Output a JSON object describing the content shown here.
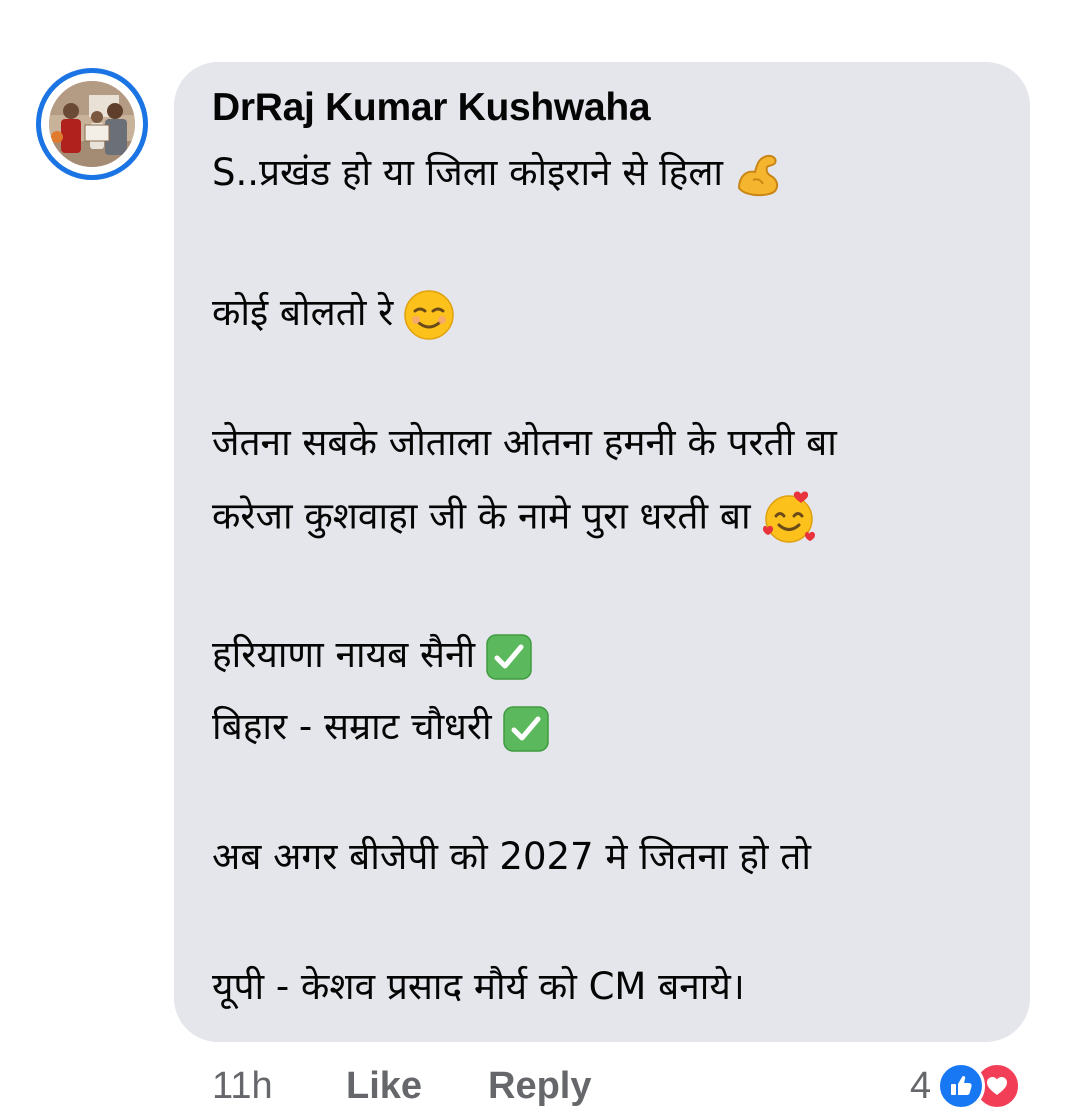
{
  "comment": {
    "author": "DrRaj Kumar Kushwaha",
    "lines": [
      {
        "text": "S..प्रखंड हो या जिला कोइराने से हिला",
        "emoji": "flexed-biceps-icon"
      },
      {
        "text": "कोई बोलतो रे",
        "emoji": "relieved-face-icon"
      },
      {
        "text": "जेतना सबके जोताला ओतना हमनी के परती बा",
        "emoji": null
      },
      {
        "text": "करेजा कुशवाहा जी के नामे पुरा धरती बा",
        "emoji": "smiling-face-with-hearts-icon"
      },
      {
        "text": "हरियाणा नायब सैनी",
        "emoji": "check-mark-button-icon"
      },
      {
        "text": "बिहार - सम्राट चौधरी",
        "emoji": "check-mark-button-icon"
      },
      {
        "text": "अब अगर बीजेपी को 2027 मे जितना हो तो",
        "emoji": null
      },
      {
        "text": "यूपी - केशव प्रसाद मौर्य को CM बनाये।",
        "emoji": null
      }
    ]
  },
  "footer": {
    "time": "11h",
    "like_label": "Like",
    "reply_label": "Reply",
    "reaction_count": "4",
    "reaction_icons": [
      "like-reaction-icon",
      "love-reaction-icon"
    ]
  },
  "colors": {
    "bubble": "#e4e6eb",
    "avatar_ring": "#1b74e4",
    "meta_text": "#65676b",
    "like": "#1877f2",
    "love": "#f33e58"
  }
}
